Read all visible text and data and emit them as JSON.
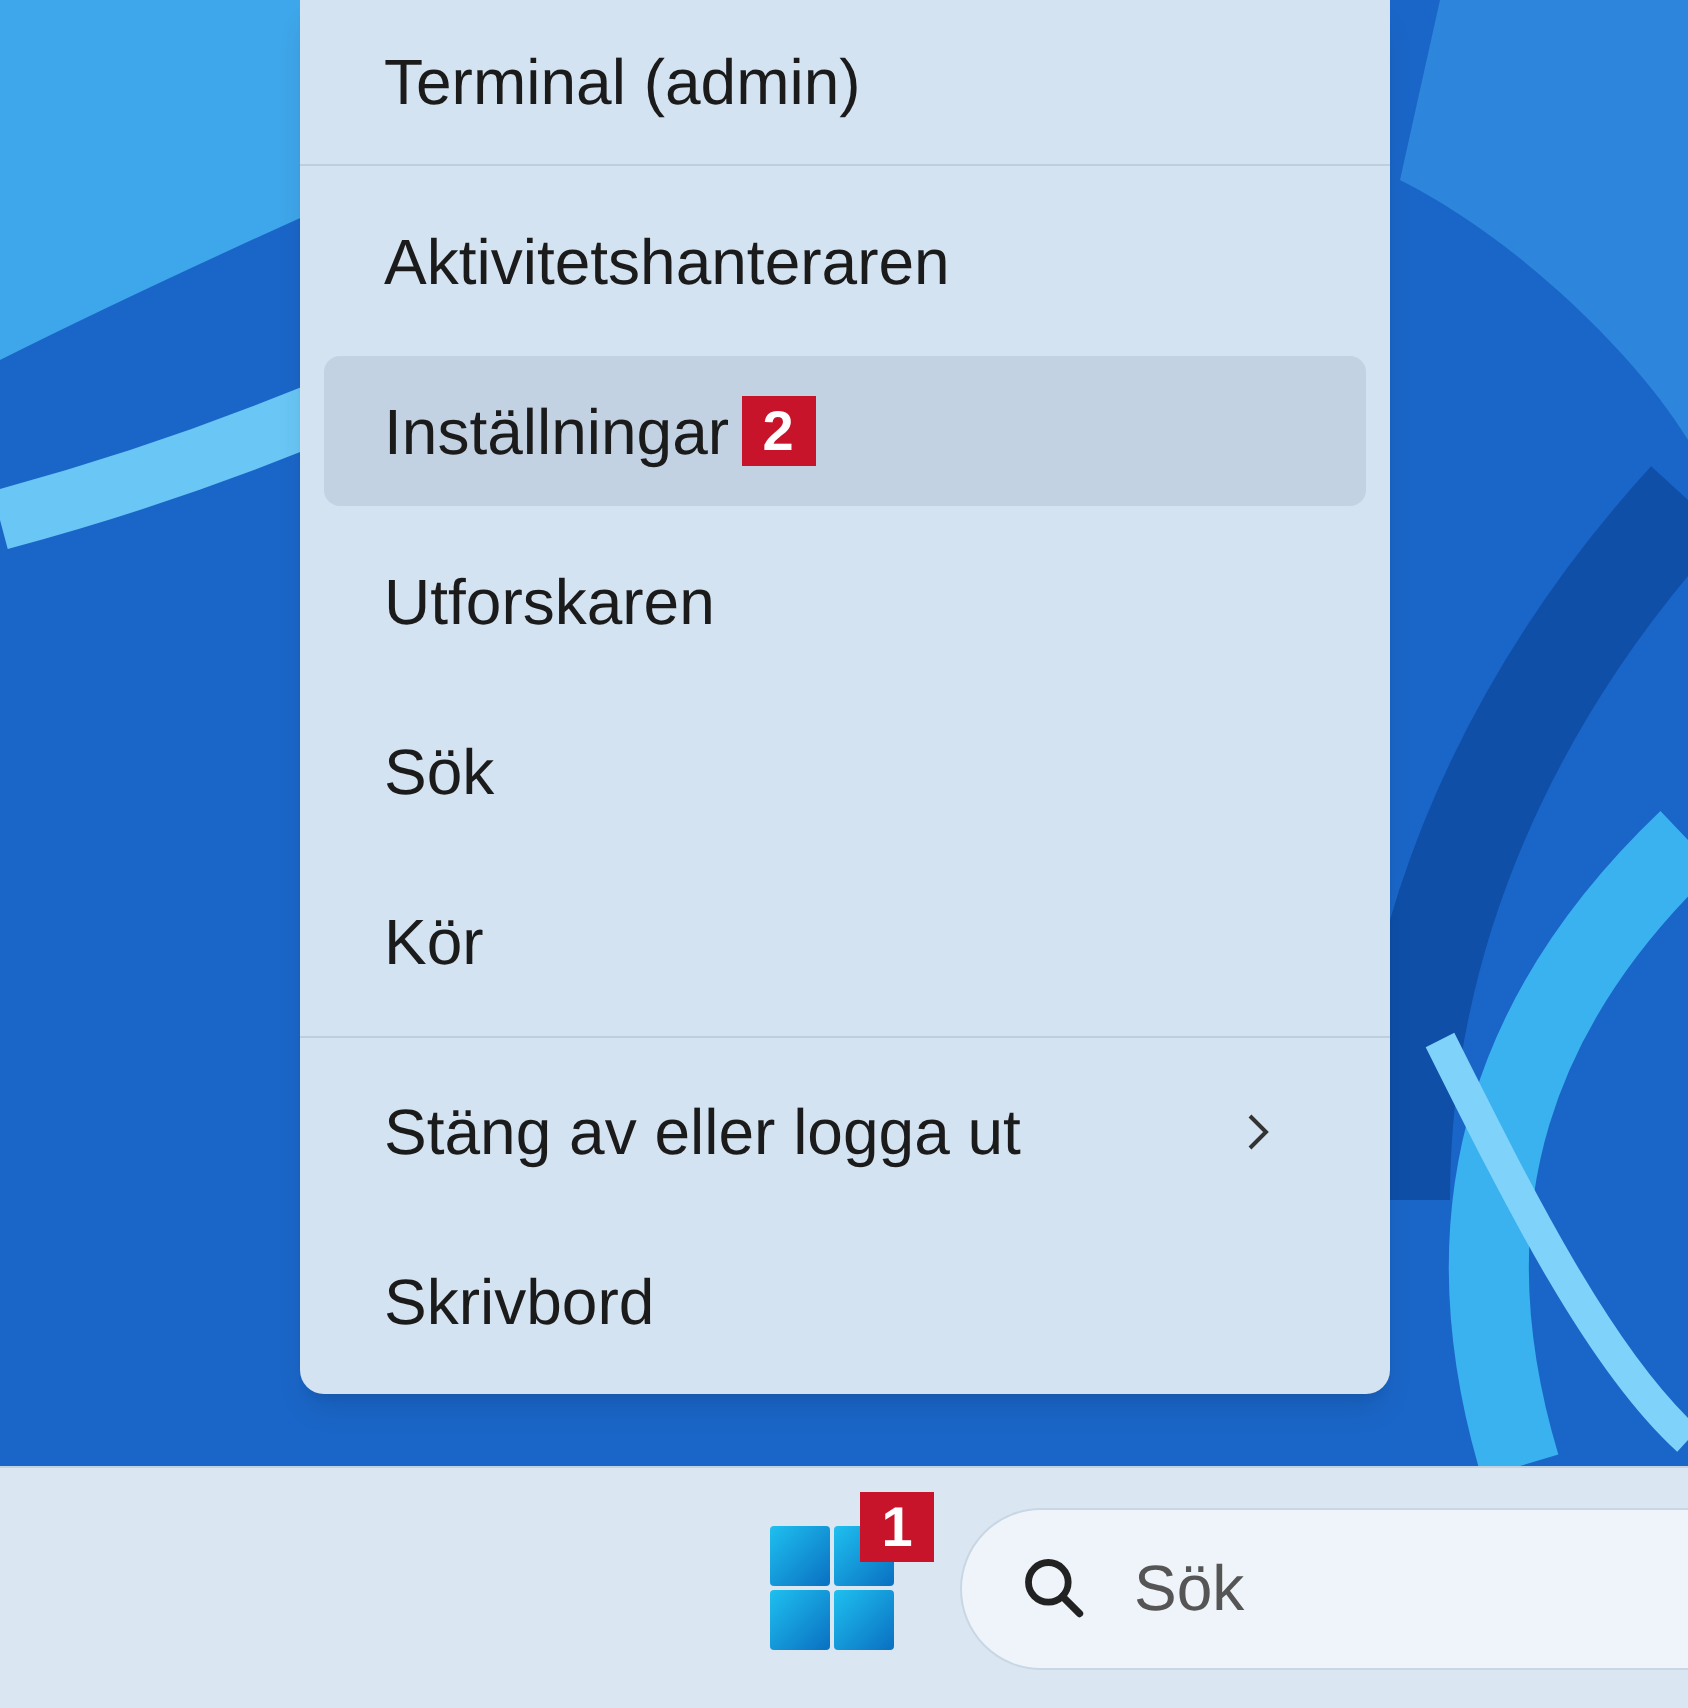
{
  "context_menu": {
    "sections": [
      {
        "items": [
          {
            "label": "Terminal (admin)",
            "selected": false,
            "has_submenu": false
          }
        ]
      },
      {
        "items": [
          {
            "label": "Aktivitetshanteraren",
            "selected": false,
            "has_submenu": false
          },
          {
            "label": "Inställningar",
            "selected": true,
            "has_submenu": false,
            "marker": "2"
          },
          {
            "label": "Utforskaren",
            "selected": false,
            "has_submenu": false
          },
          {
            "label": "Sök",
            "selected": false,
            "has_submenu": false
          },
          {
            "label": "Kör",
            "selected": false,
            "has_submenu": false
          }
        ]
      },
      {
        "items": [
          {
            "label": "Stäng av eller logga ut",
            "selected": false,
            "has_submenu": true
          },
          {
            "label": "Skrivbord",
            "selected": false,
            "has_submenu": false
          }
        ]
      }
    ]
  },
  "taskbar": {
    "start_marker": "1",
    "search": {
      "placeholder": "Sök"
    }
  }
}
